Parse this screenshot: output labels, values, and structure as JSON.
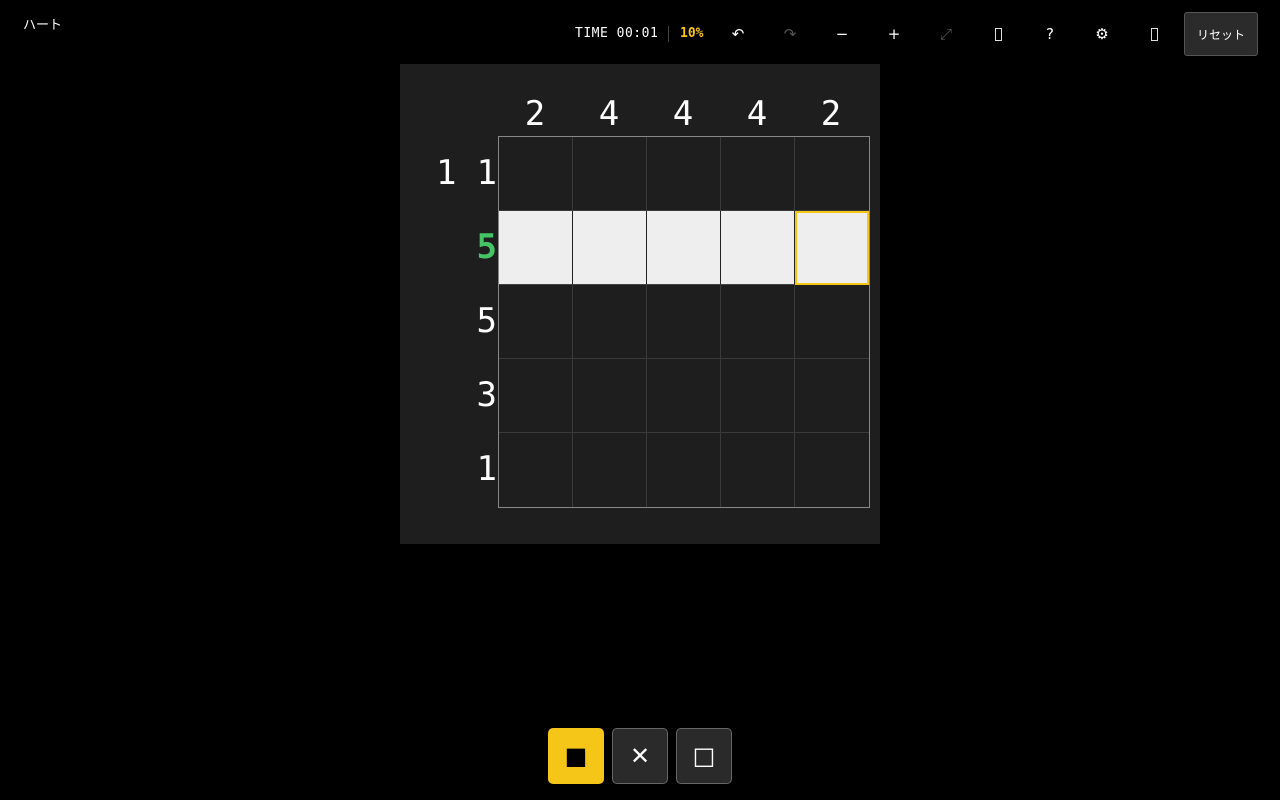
{
  "app": {
    "title": "ハート"
  },
  "toolbar": {
    "timer": "TIME 00:01",
    "progress": "10%",
    "undo_icon": "↶",
    "redo_icon": "↷",
    "zoom_out_icon": "−",
    "zoom_in_icon": "+",
    "fit_icon": "⤢",
    "help_icon": "?",
    "settings_icon": "⚙",
    "reset_label": "リセット"
  },
  "puzzle": {
    "columns": 5,
    "rows": 5,
    "col_clues": [
      "2",
      "4",
      "4",
      "4",
      "2"
    ],
    "row_clues": [
      [
        "1",
        "1"
      ],
      [
        "5"
      ],
      [
        "5"
      ],
      [
        "3"
      ],
      [
        "1"
      ]
    ],
    "active_row": 1,
    "filled_cells": [
      [
        1,
        0
      ],
      [
        1,
        1
      ],
      [
        1,
        2
      ],
      [
        1,
        3
      ],
      [
        1,
        4
      ]
    ],
    "cursor_cell": [
      1,
      4
    ],
    "colors": {
      "filled": "#eeeeee",
      "cursor": "#f5c518",
      "active_clue": "#45c466"
    }
  },
  "modes": [
    {
      "name": "fill",
      "icon": "■",
      "active": true
    },
    {
      "name": "cross",
      "icon": "✕",
      "active": false
    },
    {
      "name": "empty",
      "icon": "□",
      "active": false
    }
  ]
}
